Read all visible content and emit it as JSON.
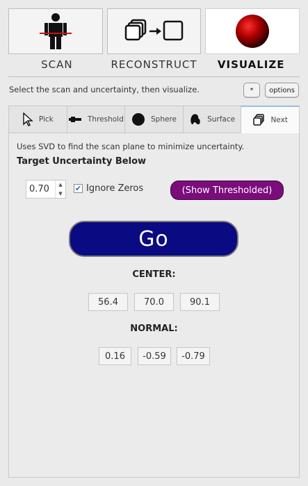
{
  "modes": [
    {
      "label": "SCAN",
      "icon": "person-scan-icon",
      "active": false
    },
    {
      "label": "RECONSTRUCT",
      "icon": "reconstruct-icon",
      "active": false
    },
    {
      "label": "VISUALIZE",
      "icon": "red-sphere-icon",
      "active": true
    }
  ],
  "instructions": "Select the scan and uncertainty, then visualize.",
  "star_button": "*",
  "options_button": "options",
  "tabs": [
    {
      "label": "Pick",
      "icon": "cursor-icon"
    },
    {
      "label": "Threshold",
      "icon": "threshold-icon"
    },
    {
      "label": "Sphere",
      "icon": "sphere-icon"
    },
    {
      "label": "Surface",
      "icon": "surface-icon"
    },
    {
      "label": "Next",
      "icon": "stacked-squares-icon",
      "active": true
    }
  ],
  "panel": {
    "description": "Uses SVD to find the scan plane to minimize uncertainty.",
    "target_label": "Target Uncertainty Below",
    "target_value": "0.70",
    "ignore_zeros_label": "Ignore Zeros",
    "ignore_zeros_checked": true,
    "show_thresholded_label": "(Show Thresholded)",
    "go_label": "Go",
    "center_label": "CENTER:",
    "center_values": [
      "56.4",
      "70.0",
      "90.1"
    ],
    "normal_label": "NORMAL:",
    "normal_values": [
      "0.16",
      "-0.59",
      "-0.79"
    ]
  },
  "colors": {
    "go_button": "#0a0a82",
    "show_thresholded_button": "#7b0c7b",
    "scan_line": "#d01010",
    "sphere": "#b00000"
  }
}
